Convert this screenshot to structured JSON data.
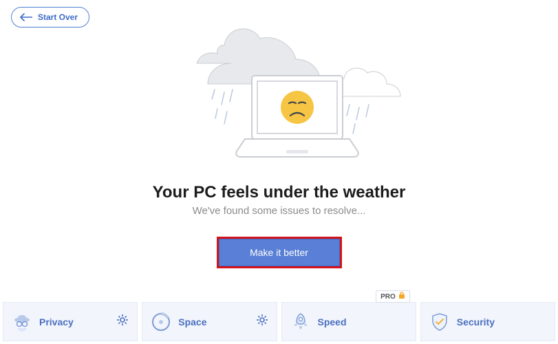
{
  "header": {
    "start_over_label": "Start Over"
  },
  "status": {
    "headline": "Your PC feels under the weather",
    "subtitle": "We've found some issues to resolve..."
  },
  "cta": {
    "label": "Make it better"
  },
  "tiles": [
    {
      "id": "privacy",
      "label": "Privacy",
      "icon": "spy-icon",
      "has_settings": true,
      "pro": false
    },
    {
      "id": "space",
      "label": "Space",
      "icon": "disk-icon",
      "has_settings": true,
      "pro": false
    },
    {
      "id": "speed",
      "label": "Speed",
      "icon": "rocket-icon",
      "has_settings": false,
      "pro": true,
      "pro_label": "PRO"
    },
    {
      "id": "security",
      "label": "Security",
      "icon": "shield-icon",
      "has_settings": false,
      "pro": false
    }
  ],
  "colors": {
    "accent": "#5a7fd6",
    "accent_border": "#3f66c1",
    "highlight_ring": "#d3121a",
    "tile_bg": "#f2f5fc",
    "link": "#3c6bc8"
  }
}
